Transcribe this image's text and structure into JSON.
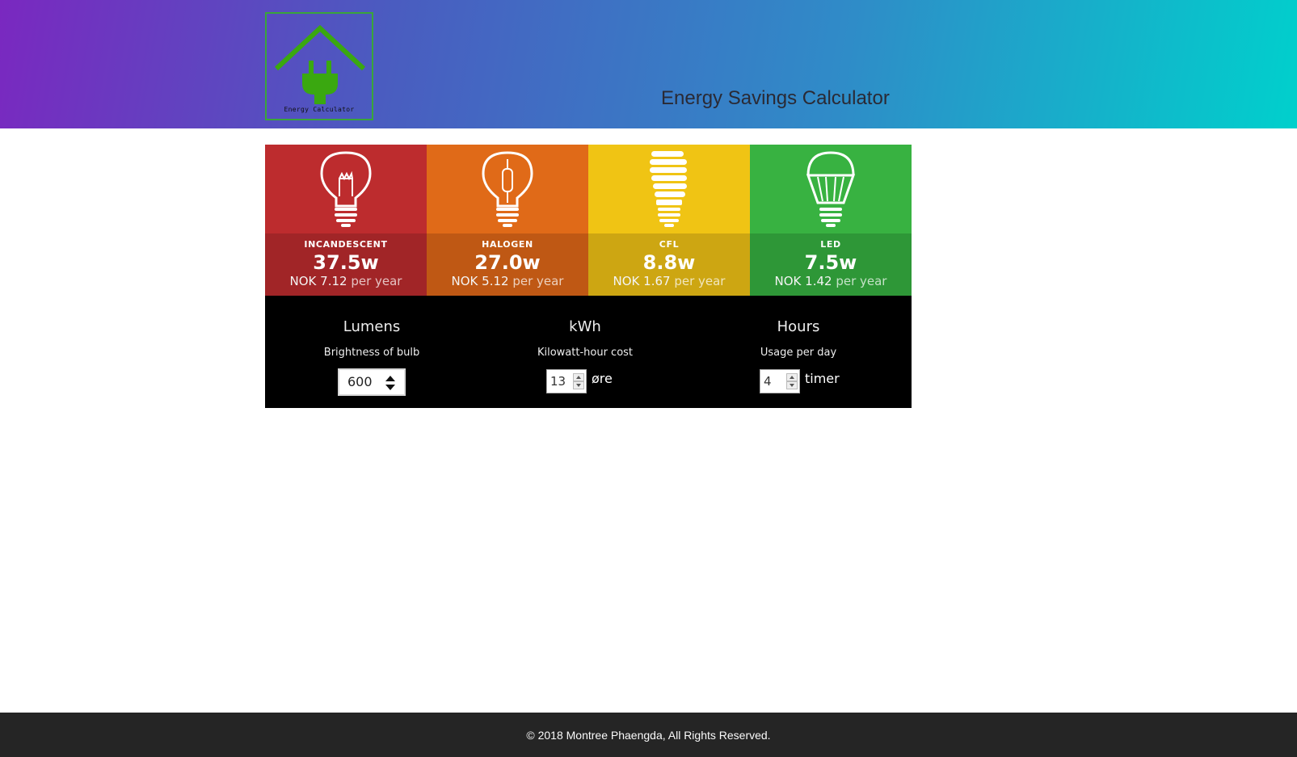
{
  "header": {
    "logo_text": "Energy Calculator",
    "title": "Energy Savings Calculator",
    "logo_icon": "house-plug-icon"
  },
  "bulbs": [
    {
      "name": "INCANDESCENT",
      "watts": "37.5w",
      "cost": "NOK 7.12",
      "per": "per year",
      "icon": "incandescent-bulb-icon",
      "color_top": "#bd2c2e",
      "color_bottom": "#a12527"
    },
    {
      "name": "HALOGEN",
      "watts": "27.0w",
      "cost": "NOK 5.12",
      "per": "per year",
      "icon": "halogen-bulb-icon",
      "color_top": "#e06a18",
      "color_bottom": "#bf5814"
    },
    {
      "name": "CFL",
      "watts": "8.8w",
      "cost": "NOK 1.67",
      "per": "per year",
      "icon": "cfl-bulb-icon",
      "color_top": "#f0c414",
      "color_bottom": "#cda612"
    },
    {
      "name": "LED",
      "watts": "7.5w",
      "cost": "NOK 1.42",
      "per": "per year",
      "icon": "led-bulb-icon",
      "color_top": "#38b241",
      "color_bottom": "#2e9737"
    }
  ],
  "controls": {
    "lumens": {
      "label": "Lumens",
      "desc": "Brightness of bulb",
      "value": "600"
    },
    "kwh": {
      "label": "kWh",
      "desc": "Kilowatt-hour cost",
      "value": "13",
      "unit": "øre"
    },
    "hours": {
      "label": "Hours",
      "desc": "Usage per day",
      "value": "4",
      "unit": "timer"
    }
  },
  "footer": {
    "text": "© 2018 Montree Phaengda, All Rights Reserved."
  }
}
